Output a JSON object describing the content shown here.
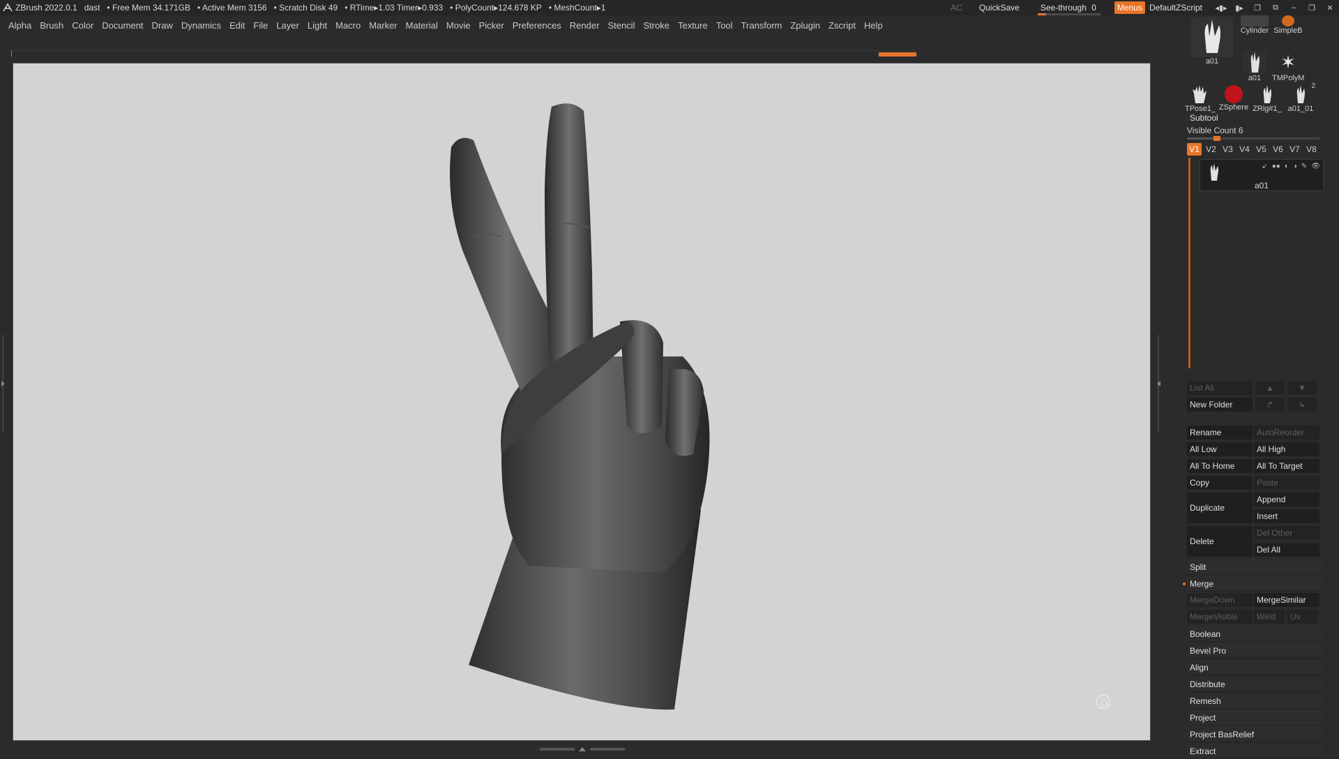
{
  "titlebar": {
    "app": "ZBrush 2022.0.1",
    "user": "dast",
    "free_mem": "• Free Mem 34.171GB",
    "active_mem": "• Active Mem 3156",
    "scratch": "• Scratch Disk 49",
    "rtime": "• RTime▸1.03 Timer▸0.933",
    "polycount": "• PolyCount▸124.678 KP",
    "meshcount": "• MeshCount▸1",
    "ac": "AC",
    "quicksave": "QuickSave",
    "seethrough": "See-through",
    "seethrough_value": "0",
    "menus": "Menus",
    "default_zscript": "DefaultZScript"
  },
  "menu": [
    "Alpha",
    "Brush",
    "Color",
    "Document",
    "Draw",
    "Dynamics",
    "Edit",
    "File",
    "Layer",
    "Light",
    "Macro",
    "Marker",
    "Material",
    "Movie",
    "Picker",
    "Preferences",
    "Render",
    "Stencil",
    "Stroke",
    "Texture",
    "Tool",
    "Transform",
    "Zplugin",
    "Zscript",
    "Help"
  ],
  "tools": {
    "big": "a01",
    "items": [
      "Cylinder",
      "SimpleB",
      "a01",
      "TMPolyM",
      "TPose1_",
      "ZSphere",
      "ZRig#1_",
      "a01_01"
    ],
    "count_badge": "2"
  },
  "subtool": {
    "header": "Subtool",
    "visible_count": "Visible Count 6",
    "versions": [
      "V1",
      "V2",
      "V3",
      "V4",
      "V5",
      "V6",
      "V7",
      "V8"
    ],
    "active_version": "V1",
    "item_name": "a01",
    "list_all": "List All",
    "new_folder": "New Folder",
    "rename": "Rename",
    "autoreorder": "AutoReorder",
    "all_low": "All Low",
    "all_high": "All High",
    "all_to_home": "All To Home",
    "all_to_target": "All To Target",
    "copy": "Copy",
    "paste": "Paste",
    "duplicate": "Duplicate",
    "append": "Append",
    "insert": "Insert",
    "delete": "Delete",
    "del_other": "Del Other",
    "del_all": "Del All",
    "split": "Split",
    "merge": "Merge",
    "mergedown": "MergeDown",
    "mergesimilar": "MergeSimilar",
    "mergevisible": "MergeVisible",
    "weld": "Weld",
    "uv": "Uv",
    "boolean": "Boolean",
    "bevel_pro": "Bevel Pro",
    "align": "Align",
    "distribute": "Distribute",
    "remesh": "Remesh",
    "project": "Project",
    "project_basrelief": "Project BasRelief",
    "extract": "Extract"
  },
  "colors": {
    "accent": "#e8752a",
    "viewport_bg": "#d3d3d1",
    "panel_bg": "#2b2b2b"
  },
  "icons": [
    "zbrush-logo-icon",
    "hand-model-icon",
    "eye-icon",
    "arrow-up-icon",
    "arrow-down-icon",
    "minimize-icon",
    "close-icon"
  ]
}
